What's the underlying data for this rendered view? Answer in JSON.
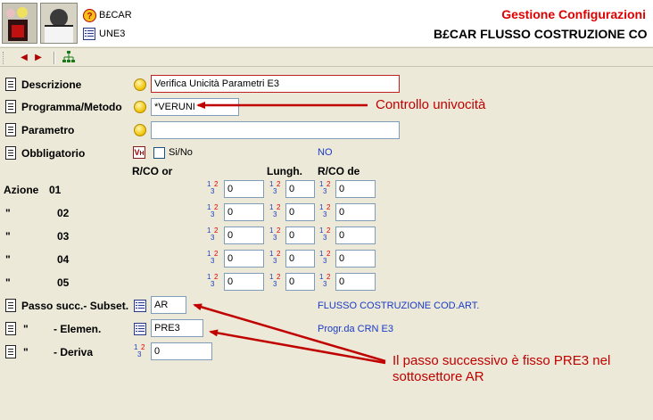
{
  "header": {
    "row1_label": "B£CAR",
    "row2_label": "UNE3",
    "title": "Gestione Configurazioni",
    "subtitle": "B£CAR FLUSSO COSTRUZIONE CO"
  },
  "form": {
    "descrizione": {
      "label": "Descrizione",
      "value": "Verifica Unicità Parametri E3"
    },
    "programma": {
      "label": "Programma/Metodo",
      "value": "*VERUNI"
    },
    "parametro": {
      "label": "Parametro",
      "value": ""
    },
    "obbligatorio": {
      "label": "Obbligatorio",
      "checkbox_label": "Si/No",
      "value_text": "NO"
    },
    "col_headers": {
      "rco_or": "R/CO or",
      "lungh": "Lungh.",
      "rco_de": "R/CO de"
    },
    "azioni": [
      {
        "prefix": "Azione",
        "num": "01",
        "or": "0",
        "lungh": "0",
        "de": "0"
      },
      {
        "prefix": "\"",
        "num": "02",
        "or": "0",
        "lungh": "0",
        "de": "0"
      },
      {
        "prefix": "\"",
        "num": "03",
        "or": "0",
        "lungh": "0",
        "de": "0"
      },
      {
        "prefix": "\"",
        "num": "04",
        "or": "0",
        "lungh": "0",
        "de": "0"
      },
      {
        "prefix": "\"",
        "num": "05",
        "or": "0",
        "lungh": "0",
        "de": "0"
      }
    ],
    "passo_subset": {
      "label": "Passo succ.- Subset.",
      "value": "AR",
      "desc": "FLUSSO COSTRUZIONE COD.ART."
    },
    "elemen": {
      "prefix": "\"",
      "label": "- Elemen.",
      "value": "PRE3",
      "desc": "Progr.da CRN E3"
    },
    "deriva": {
      "prefix": "\"",
      "label": "- Deriva",
      "value": "0"
    }
  },
  "annotations": {
    "controllo": "Controllo univocità",
    "passo_line1": "Il passo successivo è fisso PRE3 nel",
    "passo_line2": "sottosettore AR"
  },
  "colors": {
    "annotation": "#c00000",
    "title": "#e00000",
    "info_text": "#1a3ac8"
  }
}
